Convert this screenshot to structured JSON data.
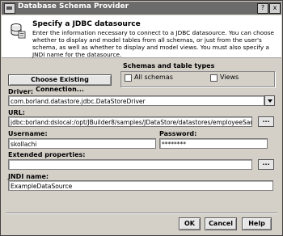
{
  "window": {
    "title": "Database Schema Provider",
    "title_buttons": [
      "?",
      "x"
    ]
  },
  "header": {
    "title": "Specify a JDBC datasource",
    "description": "Enter the information necessary to connect to a JDBC datasource. You can choose whether to display and model tables from all schemas, or just from the user's schema, as well as whether to display and model views.  You must also specify a JNDI name for the datasource."
  },
  "buttons": {
    "choose_connection": "Choose Existing Connection...",
    "ok": "OK",
    "cancel": "Cancel",
    "help": "Help",
    "ellipsis": "..."
  },
  "schema_group": {
    "title": "Schemas and table types",
    "all_schemas_label": "All schemas",
    "all_schemas_checked": false,
    "views_label": "Views",
    "views_checked": false
  },
  "driver": {
    "label": "Driver:",
    "value": "com.borland.datastore.jdbc.DataStoreDriver"
  },
  "url": {
    "label": "URL:",
    "value": "jdbc:borland:dslocal:/opt/JBuilder8/samples/JDataStore/datastores/employeeSample.jds"
  },
  "username": {
    "label": "Username:",
    "value": "skollachi"
  },
  "password": {
    "label": "Password:",
    "value": "********"
  },
  "extended": {
    "label": "Extended properties:",
    "value": ""
  },
  "jndi": {
    "label": "JNDI name:",
    "value": "ExampleDataSource"
  }
}
